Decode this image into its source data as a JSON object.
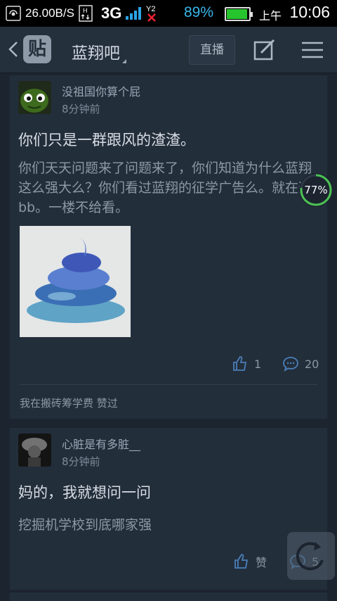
{
  "status_bar": {
    "net_speed": "26.00B/S",
    "network_type": "3G",
    "battery_percent": "89%",
    "ampm": "上午",
    "time": "10:06",
    "battery_level": 0.89,
    "colors": {
      "battery": "#27c52d",
      "accent": "#39b6ea"
    }
  },
  "header": {
    "logo_text": "贴",
    "title": "蓝翔吧",
    "live_label": "直播"
  },
  "posts": [
    {
      "author": "没祖国你算个屁",
      "time": "8分钟前",
      "title": "你们只是一群跟风的渣渣。",
      "body": "你们天天问题来了问题来了，你们知道为什么蓝翔这么强大么？你们看过蓝翔的征学广告么。就在这bb。一楼不给看。",
      "likes": "1",
      "comments": "20",
      "liked_by": "我在搬砖筹学费 赞过"
    },
    {
      "author": "心脏是有多脏__",
      "time": "8分钟前",
      "title": "妈的，我就想问一问",
      "body": "挖掘机学校到底哪家强",
      "like_label": "赞",
      "comments": "5"
    }
  ],
  "load_progress": {
    "label": "77%",
    "value": 0.77,
    "color": "#4cc153"
  }
}
